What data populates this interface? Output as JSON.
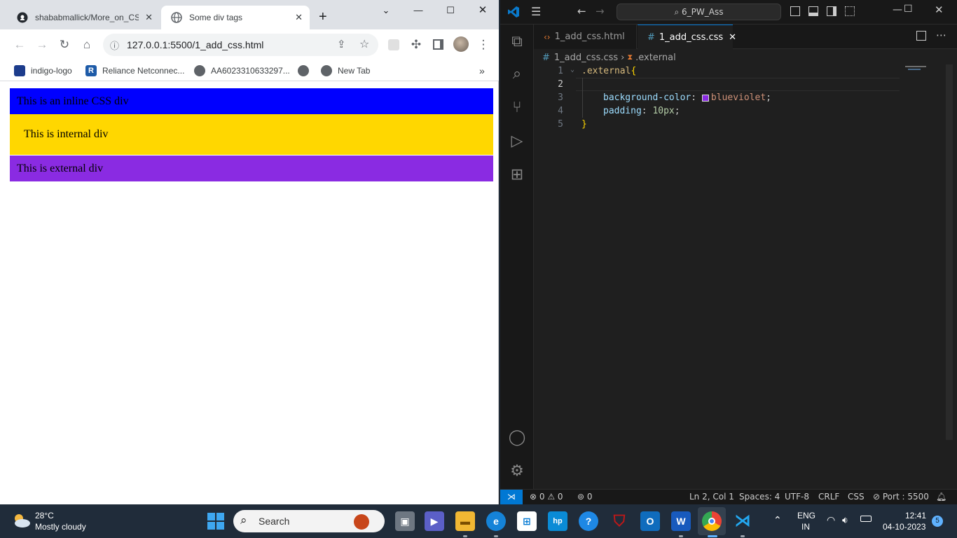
{
  "chrome": {
    "tabs": [
      {
        "title": "shababmallick/More_on_CS",
        "icon": "github-icon",
        "active": false
      },
      {
        "title": "Some div tags",
        "icon": "globe-icon",
        "active": true
      }
    ],
    "new_tab": "+",
    "url": "127.0.0.1:5500/1_add_css.html",
    "bookmarks": [
      {
        "label": "indigo-logo",
        "icon": "indigo-icon"
      },
      {
        "label": "Reliance Netconnec...",
        "icon": "reliance-icon"
      },
      {
        "label": "AA6023310633297...",
        "icon": "globe-icon"
      },
      {
        "label": "",
        "icon": "globe-icon"
      },
      {
        "label": "New Tab",
        "icon": "globe-icon"
      }
    ],
    "bookmarks_overflow": "»",
    "page": {
      "inline_div": {
        "text": "This is an inline CSS div",
        "bg": "#0000ff"
      },
      "internal_div": {
        "text": "This is internal div",
        "bg": "#ffd700"
      },
      "external_div": {
        "text": "This is external div",
        "bg": "#8a2be2"
      }
    }
  },
  "vscode": {
    "search": "6_PW_Ass",
    "tabs": [
      {
        "label": "1_add_css.html",
        "icon": "html-icon",
        "active": false
      },
      {
        "label": "1_add_css.css",
        "icon": "css-hash-icon",
        "active": true
      }
    ],
    "breadcrumb": {
      "file": "1_add_css.css",
      "symbol": ".external"
    },
    "code": {
      "line_numbers": [
        "1",
        "2",
        "3",
        "4",
        "5"
      ],
      "selector": ".external",
      "open_brace": "{",
      "close_brace": "}",
      "prop1": "background-color",
      "val1": "blueviolet",
      "swatch_color": "#8a2be2",
      "prop2": "padding",
      "val2": "10px",
      "colon": ":",
      "semi": ";"
    },
    "status": {
      "errors": "0",
      "warnings": "0",
      "ports": "0",
      "cursor": "Ln 2, Col 1",
      "spaces": "Spaces: 4",
      "encoding": "UTF-8",
      "eol": "CRLF",
      "language": "CSS",
      "port": "Port : 5500"
    }
  },
  "taskbar": {
    "weather_temp": "28°C",
    "weather_desc": "Mostly cloudy",
    "search": "Search",
    "lang_top": "ENG",
    "lang_bottom": "IN",
    "time": "12:41",
    "date": "04-10-2023",
    "notif_count": "5"
  }
}
